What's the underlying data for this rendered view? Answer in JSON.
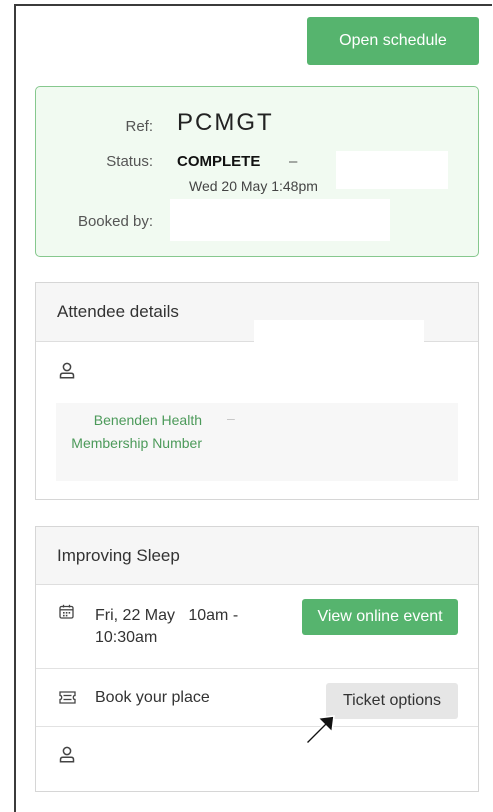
{
  "header": {
    "open_schedule_label": "Open schedule"
  },
  "booking": {
    "ref_label": "Ref:",
    "ref_value": "PCMGT",
    "status_label": "Status:",
    "status_value": "COMPLETE",
    "status_separator": "–",
    "status_date": "Wed 20 May 1:48pm",
    "booked_by_label": "Booked by:"
  },
  "attendee": {
    "title": "Attendee details",
    "membership_label": "Benenden Health Membership Number",
    "membership_separator": "–"
  },
  "event": {
    "title": "Improving Sleep",
    "date_line1": "Fri, 22 May   10am -",
    "date_line2": "10:30am",
    "view_label": "View online event",
    "book_label": "Book your place",
    "ticket_label": "Ticket options"
  },
  "colors": {
    "accent_green": "#56b46e",
    "card_bg": "#f1faf1",
    "card_border": "#86c88e",
    "link_green": "#4c9a5a"
  }
}
